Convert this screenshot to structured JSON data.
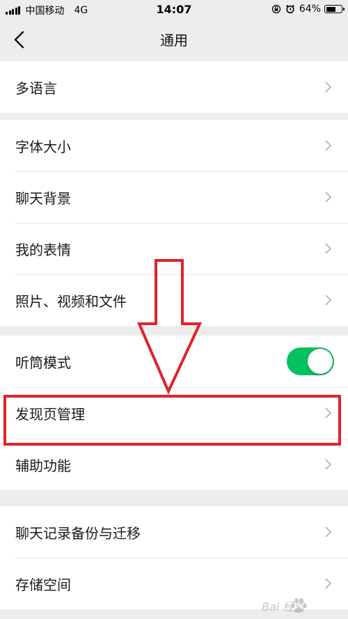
{
  "status_bar": {
    "carrier": "中国移动",
    "network": "4G",
    "time": "14:07",
    "battery_percent": "64%",
    "battery_level": 0.64
  },
  "nav": {
    "title": "通用",
    "back_icon": "chevron-left-icon"
  },
  "groups": [
    {
      "items": [
        {
          "label": "多语言",
          "type": "link"
        }
      ]
    },
    {
      "items": [
        {
          "label": "字体大小",
          "type": "link"
        },
        {
          "label": "聊天背景",
          "type": "link"
        },
        {
          "label": "我的表情",
          "type": "link"
        },
        {
          "label": "照片、视频和文件",
          "type": "link"
        }
      ]
    },
    {
      "items": [
        {
          "label": "听筒模式",
          "type": "toggle",
          "on": true
        },
        {
          "label": "发现页管理",
          "type": "link",
          "highlighted": true
        },
        {
          "label": "辅助功能",
          "type": "link"
        }
      ]
    },
    {
      "items": [
        {
          "label": "聊天记录备份与迁移",
          "type": "link"
        },
        {
          "label": "存储空间",
          "type": "link"
        }
      ]
    }
  ],
  "colors": {
    "toggle_on": "#07c160",
    "annotation_red": "#e0222c",
    "background": "#ededed"
  },
  "watermark": {
    "icon": "baidu-paw-icon",
    "text": "Bai 经验"
  }
}
